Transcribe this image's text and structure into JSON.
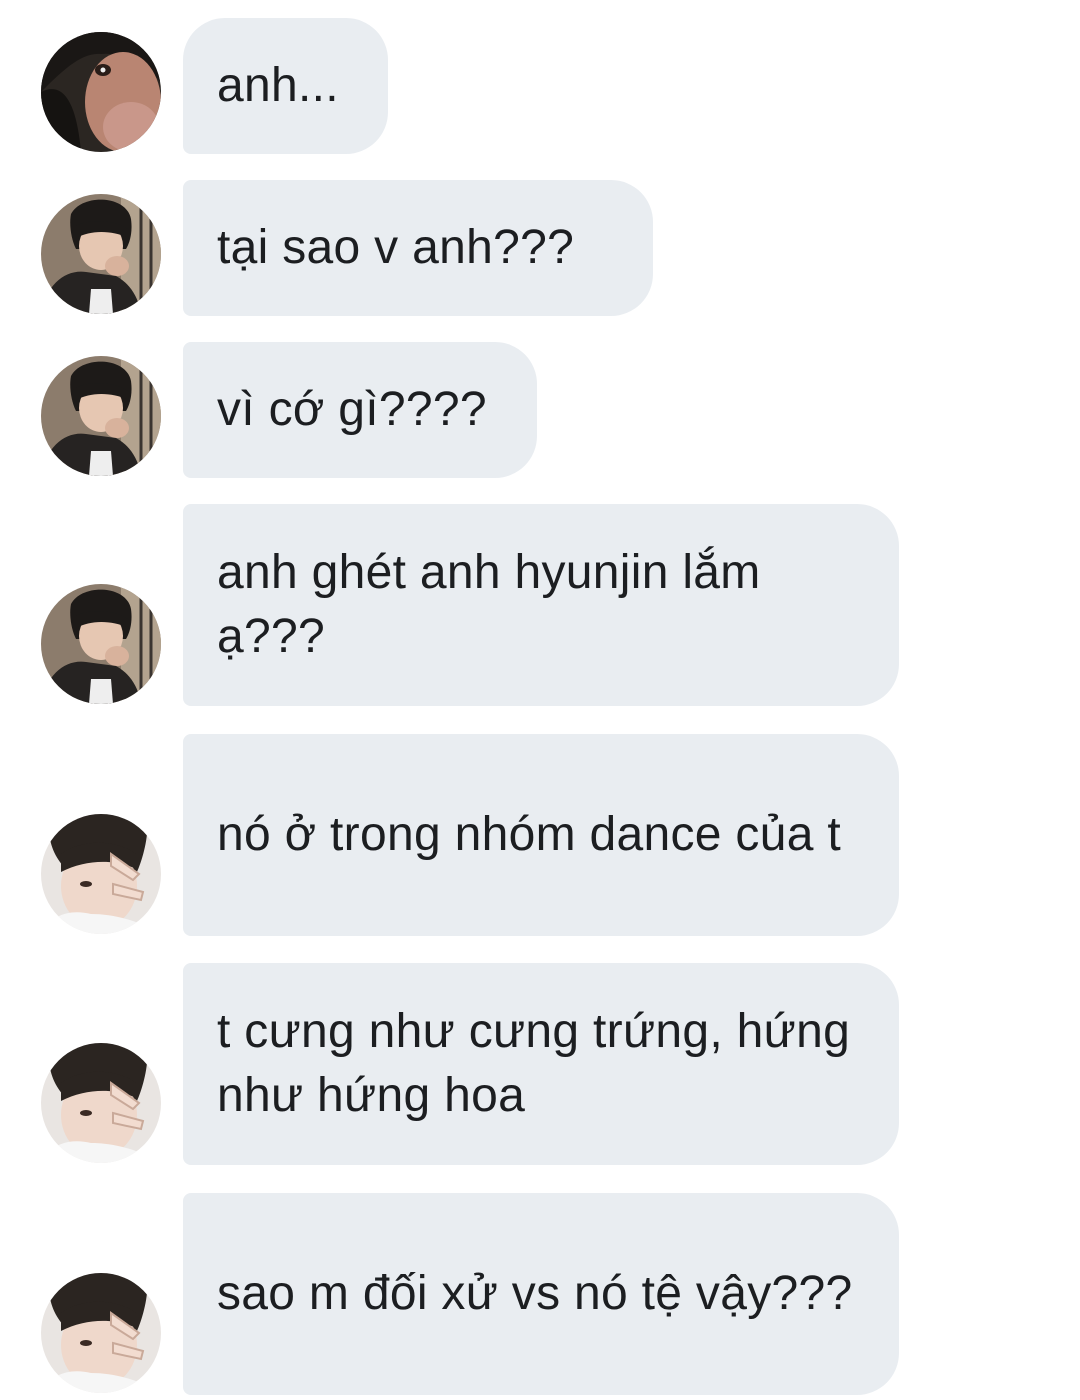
{
  "messages": [
    {
      "sender": "user-a",
      "text": "anh..."
    },
    {
      "sender": "user-b",
      "text": "tại sao v anh???"
    },
    {
      "sender": "user-b",
      "text": "vì cớ gì????"
    },
    {
      "sender": "user-b",
      "text": "anh ghét anh hyunjin lắm ạ???"
    },
    {
      "sender": "user-c",
      "text": "nó ở trong nhóm dance của t"
    },
    {
      "sender": "user-c",
      "text": "t cưng như cưng trứng, hứng như hứng hoa"
    },
    {
      "sender": "user-c",
      "text": "sao m đối xử vs nó tệ vậy???"
    }
  ],
  "colors": {
    "bubble": "#e9edf1",
    "text": "#1c1e21",
    "background": "#ffffff"
  }
}
